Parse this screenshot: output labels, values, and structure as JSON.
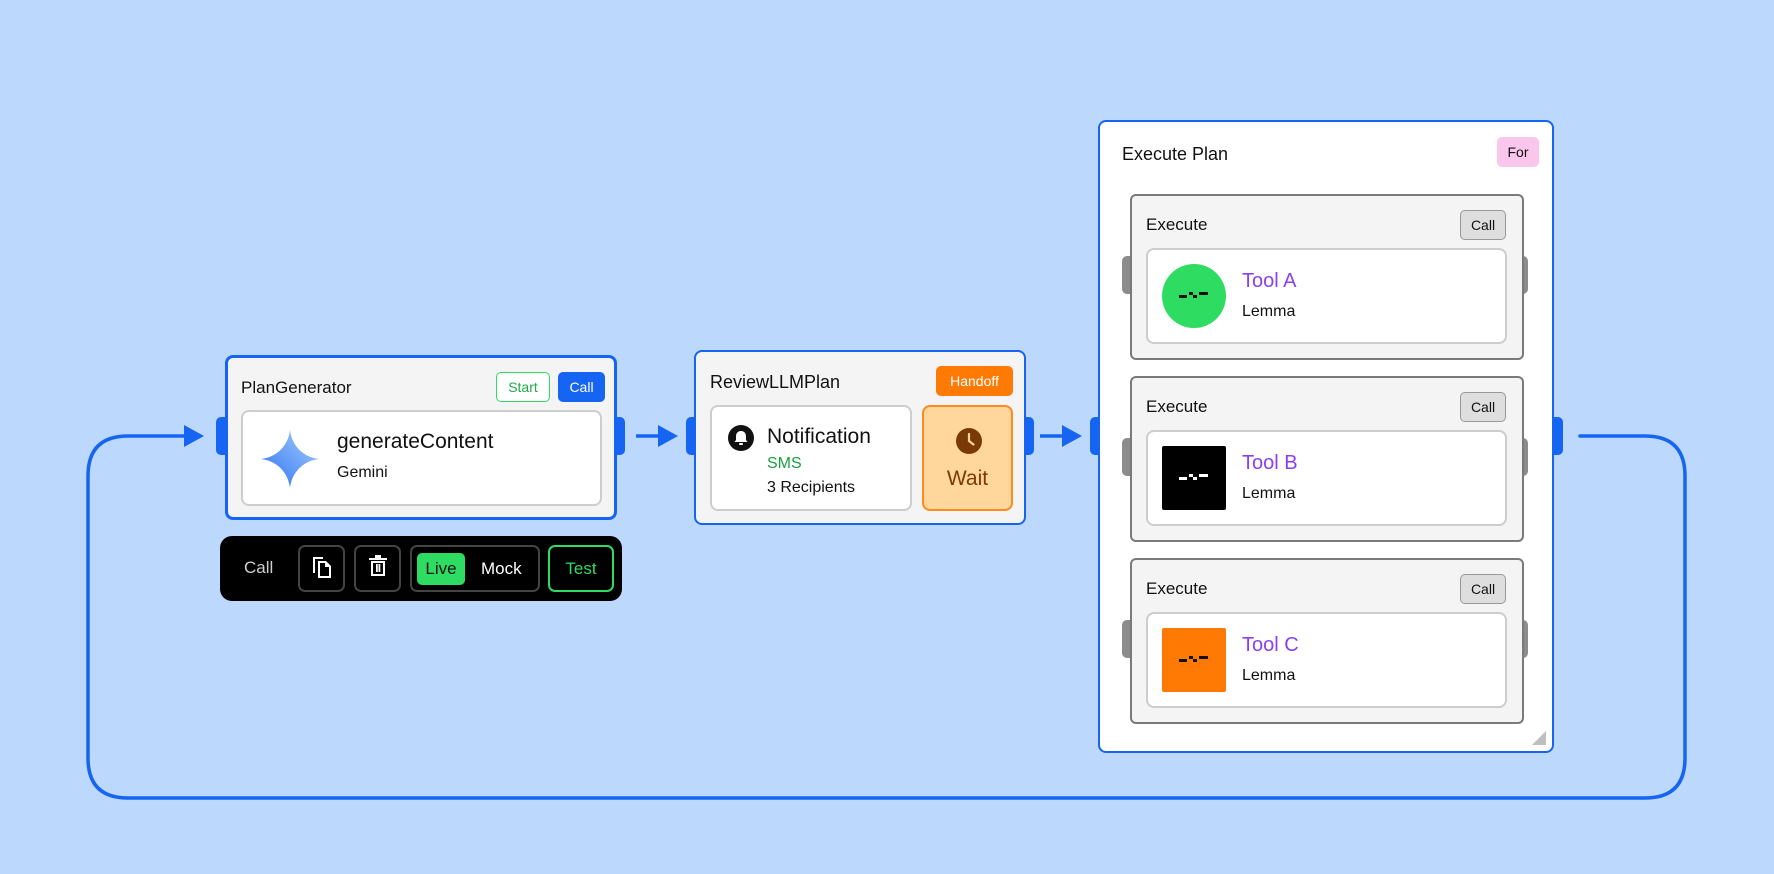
{
  "colors": {
    "canvas": "#bdd8fd",
    "accent": "#1565f2",
    "green": "#2edc62",
    "orange": "#ff7a05",
    "purple": "#8a3ff0",
    "pink": "#fbc6ec"
  },
  "plan_generator": {
    "title": "PlanGenerator",
    "start_label": "Start",
    "call_label": "Call",
    "card_title": "generateContent",
    "card_subtitle": "Gemini",
    "icon": "gemini-sparkle-icon"
  },
  "toolbar": {
    "call_label": "Call",
    "copy_icon": "copy-icon",
    "delete_icon": "trash-icon",
    "live_label": "Live",
    "mock_label": "Mock",
    "test_label": "Test"
  },
  "review": {
    "title": "ReviewLLMPlan",
    "handoff_label": "Handoff",
    "notification_title": "Notification",
    "notification_channel": "SMS",
    "notification_recipients": "3 Recipients",
    "bell_icon": "bell-icon",
    "wait_label": "Wait",
    "clock_icon": "clock-icon"
  },
  "execute_plan": {
    "title": "Execute Plan",
    "for_label": "For",
    "items": [
      {
        "title": "Execute",
        "call_label": "Call",
        "tool_name": "Tool A",
        "tool_sub": "Lemma",
        "logo_color": "#2edc62",
        "logo_shape": "circle"
      },
      {
        "title": "Execute",
        "call_label": "Call",
        "tool_name": "Tool B",
        "tool_sub": "Lemma",
        "logo_color": "#000000",
        "logo_shape": "square"
      },
      {
        "title": "Execute",
        "call_label": "Call",
        "tool_name": "Tool C",
        "tool_sub": "Lemma",
        "logo_color": "#ff7a05",
        "logo_shape": "square"
      }
    ]
  }
}
